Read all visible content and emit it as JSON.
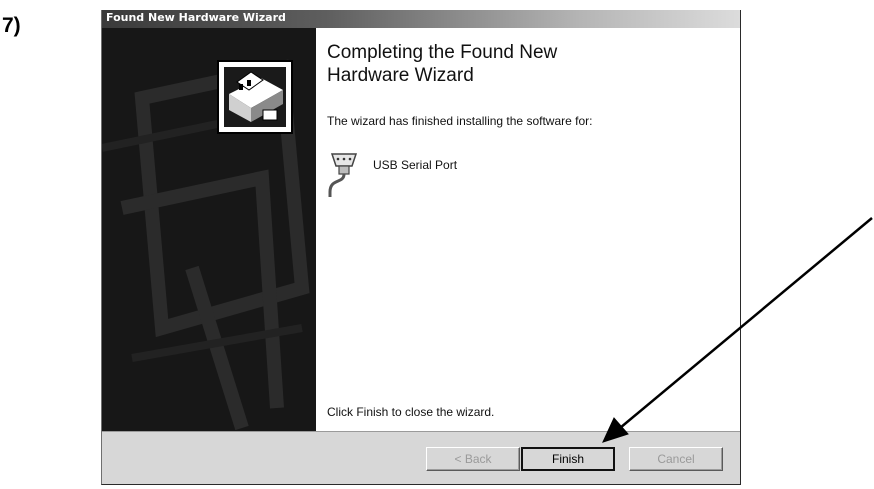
{
  "step_label": "7)",
  "window": {
    "title": "Found New Hardware Wizard"
  },
  "content": {
    "heading": "Completing the Found New Hardware Wizard",
    "intro": "The wizard has finished installing the software for:",
    "device": {
      "name": "USB Serial Port",
      "icon": "serial-port-icon"
    },
    "closing": "Click Finish to close the wizard."
  },
  "side_panel": {
    "icon": "hardware-wizard-icon"
  },
  "buttons": {
    "back": {
      "label": "< Back",
      "enabled": false
    },
    "finish": {
      "label": "Finish",
      "enabled": true,
      "default": true
    },
    "cancel": {
      "label": "Cancel",
      "enabled": false
    }
  },
  "annotation": {
    "type": "arrow",
    "target": "finish-button"
  }
}
